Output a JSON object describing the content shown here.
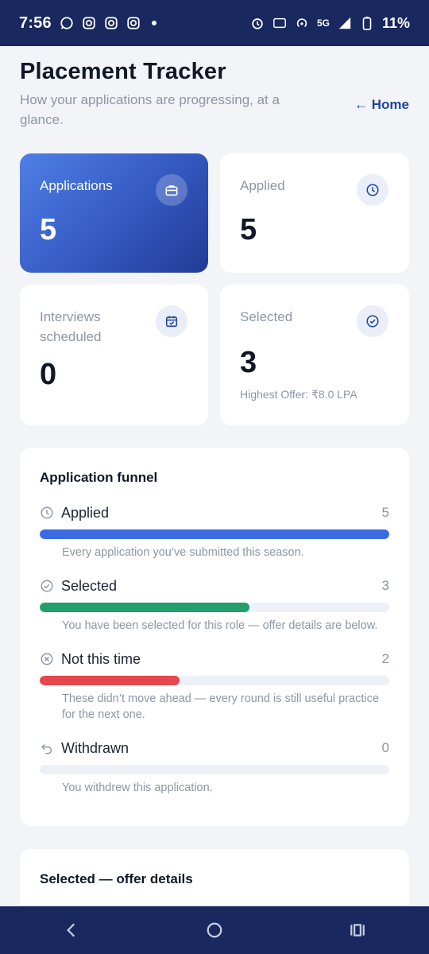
{
  "status_bar": {
    "time": "7:56",
    "network": "5G",
    "battery": "11%"
  },
  "header": {
    "title": "Placement Tracker",
    "subtitle": "How your applications are progressing, at a glance.",
    "home_link": "← Home"
  },
  "stats": [
    {
      "label": "Applications",
      "value": "5",
      "icon": "briefcase-icon"
    },
    {
      "label": "Applied",
      "value": "5",
      "icon": "clock-icon"
    },
    {
      "label": "Interviews scheduled",
      "value": "0",
      "icon": "calendar-icon"
    },
    {
      "label": "Selected",
      "value": "3",
      "note": "Highest Offer: ₹8.0 LPA",
      "icon": "check-circle-icon"
    }
  ],
  "funnel": {
    "title": "Application funnel",
    "total": 5,
    "items": [
      {
        "name": "Applied",
        "count": "5",
        "value": 5,
        "color": "#3b6ae3",
        "icon": "clock-icon",
        "desc": "Every application you’ve submitted this season."
      },
      {
        "name": "Selected",
        "count": "3",
        "value": 3,
        "color": "#22a06b",
        "icon": "check-circle-icon",
        "desc": "You have been selected for this role — offer details are below."
      },
      {
        "name": "Not this time",
        "count": "2",
        "value": 2,
        "color": "#e5484d",
        "icon": "x-circle-icon",
        "desc": "These didn’t move ahead — every round is still useful practice for the next one."
      },
      {
        "name": "Withdrawn",
        "count": "0",
        "value": 0,
        "color": "#9aa3b2",
        "icon": "undo-icon",
        "desc": "You withdrew this application."
      }
    ]
  },
  "offer_section": {
    "title": "Selected — offer details"
  }
}
